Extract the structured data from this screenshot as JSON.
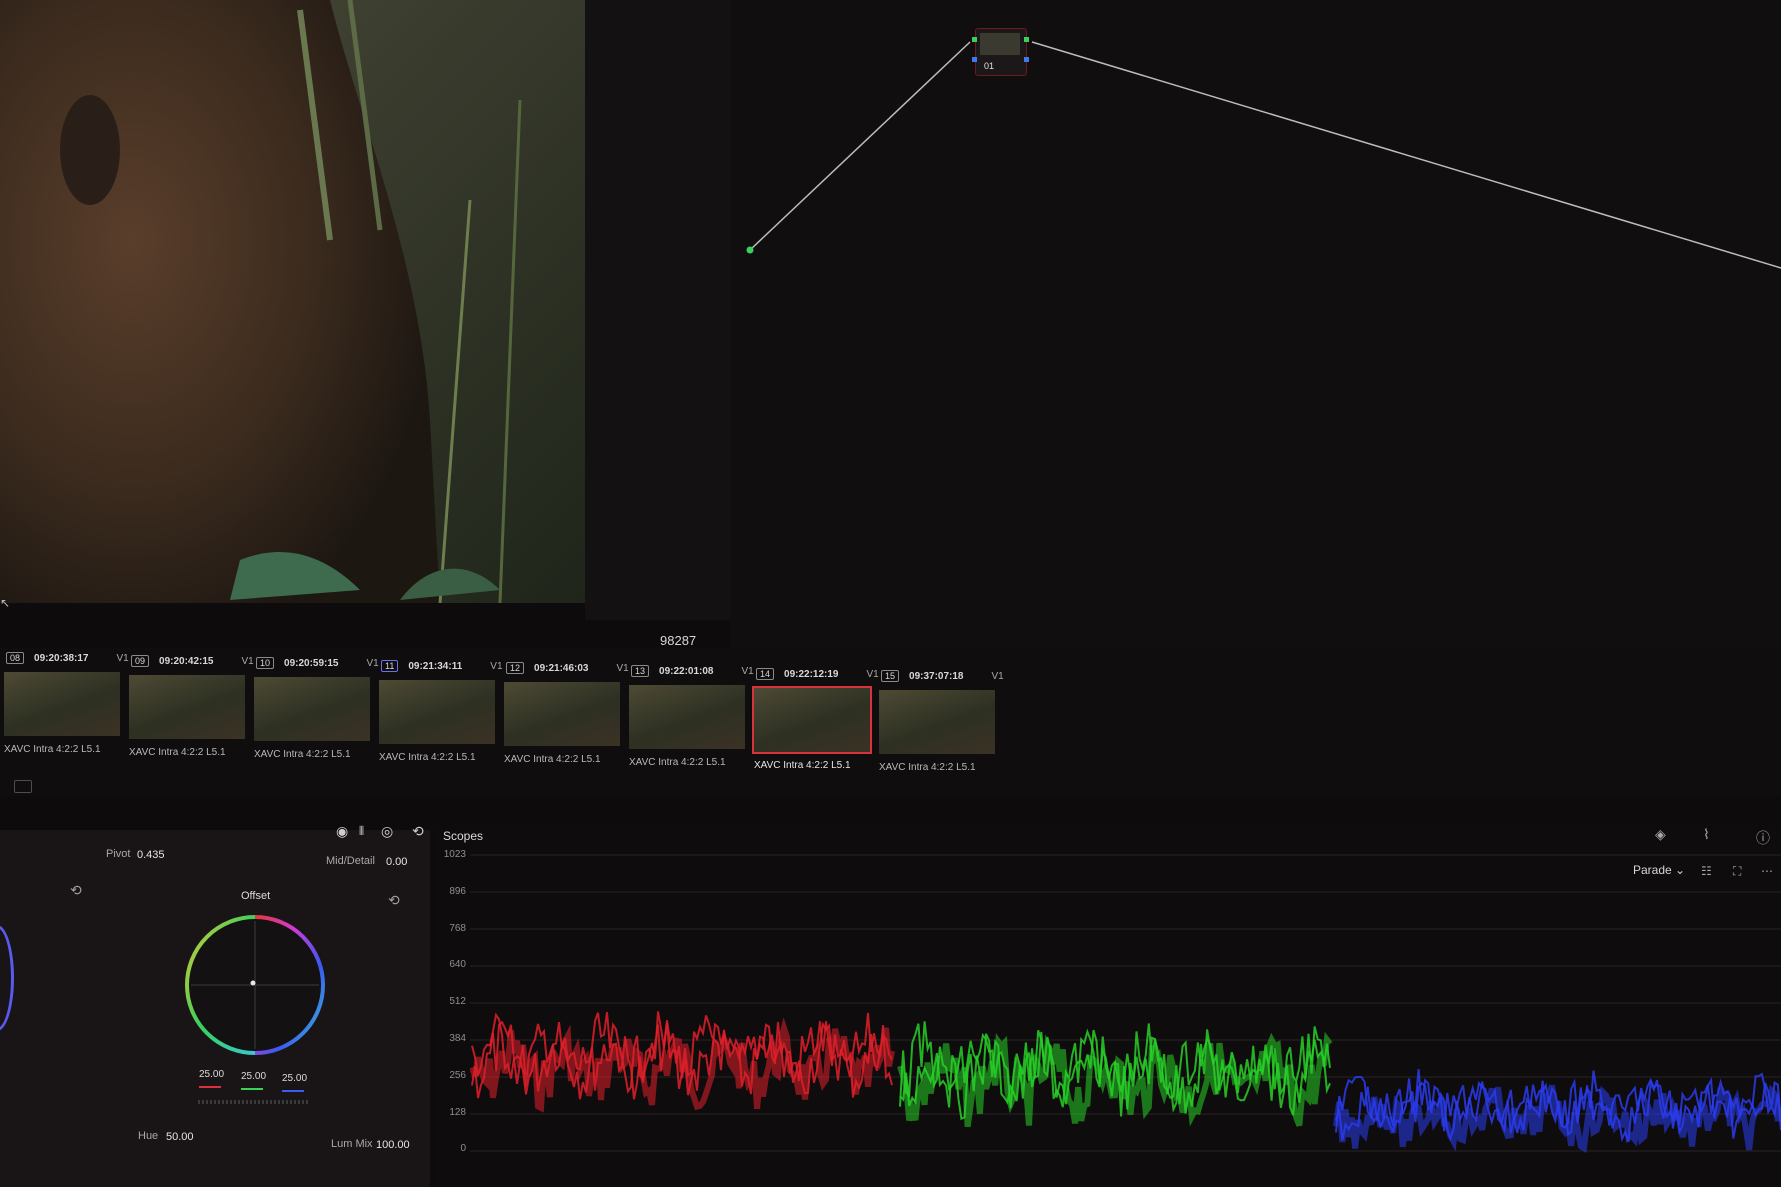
{
  "viewer": {
    "frame_count": "98287"
  },
  "node_graph": {
    "nodes": [
      {
        "label": "01"
      }
    ]
  },
  "clips": [
    {
      "num": "08",
      "timecode": "09:20:38:17",
      "track": "V1",
      "codec": "XAVC Intra 4:2:2 L5.1",
      "selected": false
    },
    {
      "num": "09",
      "timecode": "09:20:42:15",
      "track": "V1",
      "codec": "XAVC Intra 4:2:2 L5.1",
      "selected": false
    },
    {
      "num": "10",
      "timecode": "09:20:59:15",
      "track": "V1",
      "codec": "XAVC Intra 4:2:2 L5.1",
      "selected": false
    },
    {
      "num": "11",
      "timecode": "09:21:34:11",
      "track": "V1",
      "codec": "XAVC Intra 4:2:2 L5.1",
      "selected": false
    },
    {
      "num": "12",
      "timecode": "09:21:46:03",
      "track": "V1",
      "codec": "XAVC Intra 4:2:2 L5.1",
      "selected": false
    },
    {
      "num": "13",
      "timecode": "09:22:01:08",
      "track": "V1",
      "codec": "XAVC Intra 4:2:2 L5.1",
      "selected": false
    },
    {
      "num": "14",
      "timecode": "09:22:12:19",
      "track": "V1",
      "codec": "XAVC Intra 4:2:2 L5.1",
      "selected": true
    },
    {
      "num": "15",
      "timecode": "09:37:07:18",
      "track": "V1",
      "codec": "XAVC Intra 4:2:2 L5.1",
      "selected": false
    }
  ],
  "wheel_panel": {
    "pivot_label": "Pivot",
    "pivot_value": "0.435",
    "middetail_label": "Mid/Detail",
    "middetail_value": "0.00",
    "wheel_title": "Offset",
    "offset_r": "25.00",
    "offset_g": "25.00",
    "offset_b": "25.00",
    "hue_label": "Hue",
    "hue_value": "50.00",
    "lummix_label": "Lum Mix",
    "lummix_value": "100.00",
    "toolbar_icons": [
      "wheel-mode-icon",
      "bars-icon",
      "log-icon",
      "reset-icon"
    ]
  },
  "scopes": {
    "title": "Scopes",
    "mode": "Parade",
    "ticks": [
      "1023",
      "896",
      "768",
      "640",
      "512",
      "384",
      "256",
      "128",
      "0"
    ],
    "colors": {
      "red": "#e0202a",
      "green": "#28d028",
      "blue": "#2a3cf0"
    }
  }
}
